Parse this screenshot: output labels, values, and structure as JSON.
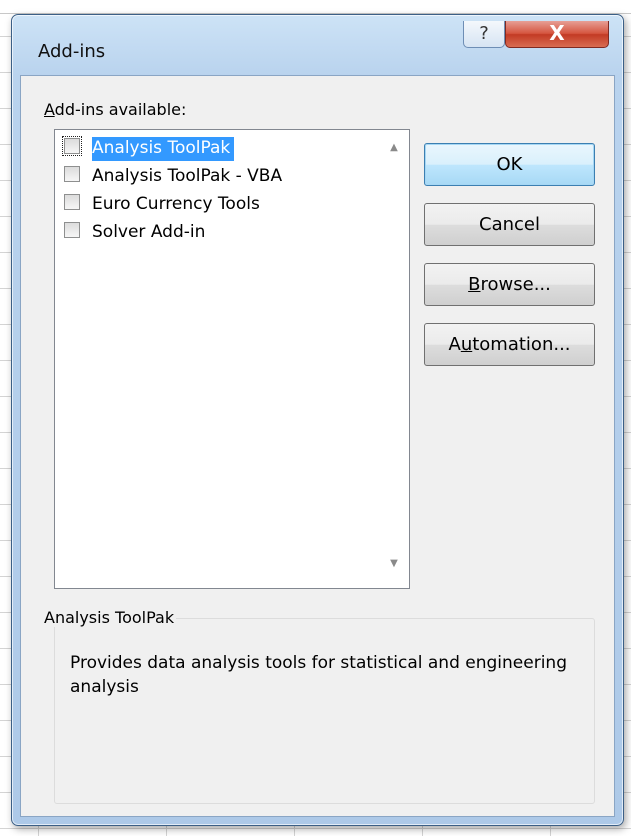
{
  "dialog": {
    "title": "Add-ins",
    "help_glyph": "?",
    "close_glyph": "X"
  },
  "list": {
    "label_accel": "A",
    "label_rest": "dd-ins available:",
    "items": [
      {
        "label": "Analysis ToolPak",
        "checked": false,
        "selected": true
      },
      {
        "label": "Analysis ToolPak - VBA",
        "checked": false,
        "selected": false
      },
      {
        "label": "Euro Currency Tools",
        "checked": false,
        "selected": false
      },
      {
        "label": "Solver Add-in",
        "checked": false,
        "selected": false
      }
    ],
    "scroll_up_icon": "triangle-up",
    "scroll_down_icon": "triangle-down"
  },
  "buttons": {
    "ok": "OK",
    "cancel": "Cancel",
    "browse_accel": "B",
    "browse_rest": "rowse...",
    "automation_pre": "A",
    "automation_accel": "u",
    "automation_rest": "tomation..."
  },
  "description": {
    "title": "Analysis ToolPak",
    "text": "Provides data analysis tools for statistical and engineering analysis"
  },
  "colors": {
    "selection": "#3399ff",
    "close_button": "#c9442c",
    "frame": "#b9d3ee"
  }
}
